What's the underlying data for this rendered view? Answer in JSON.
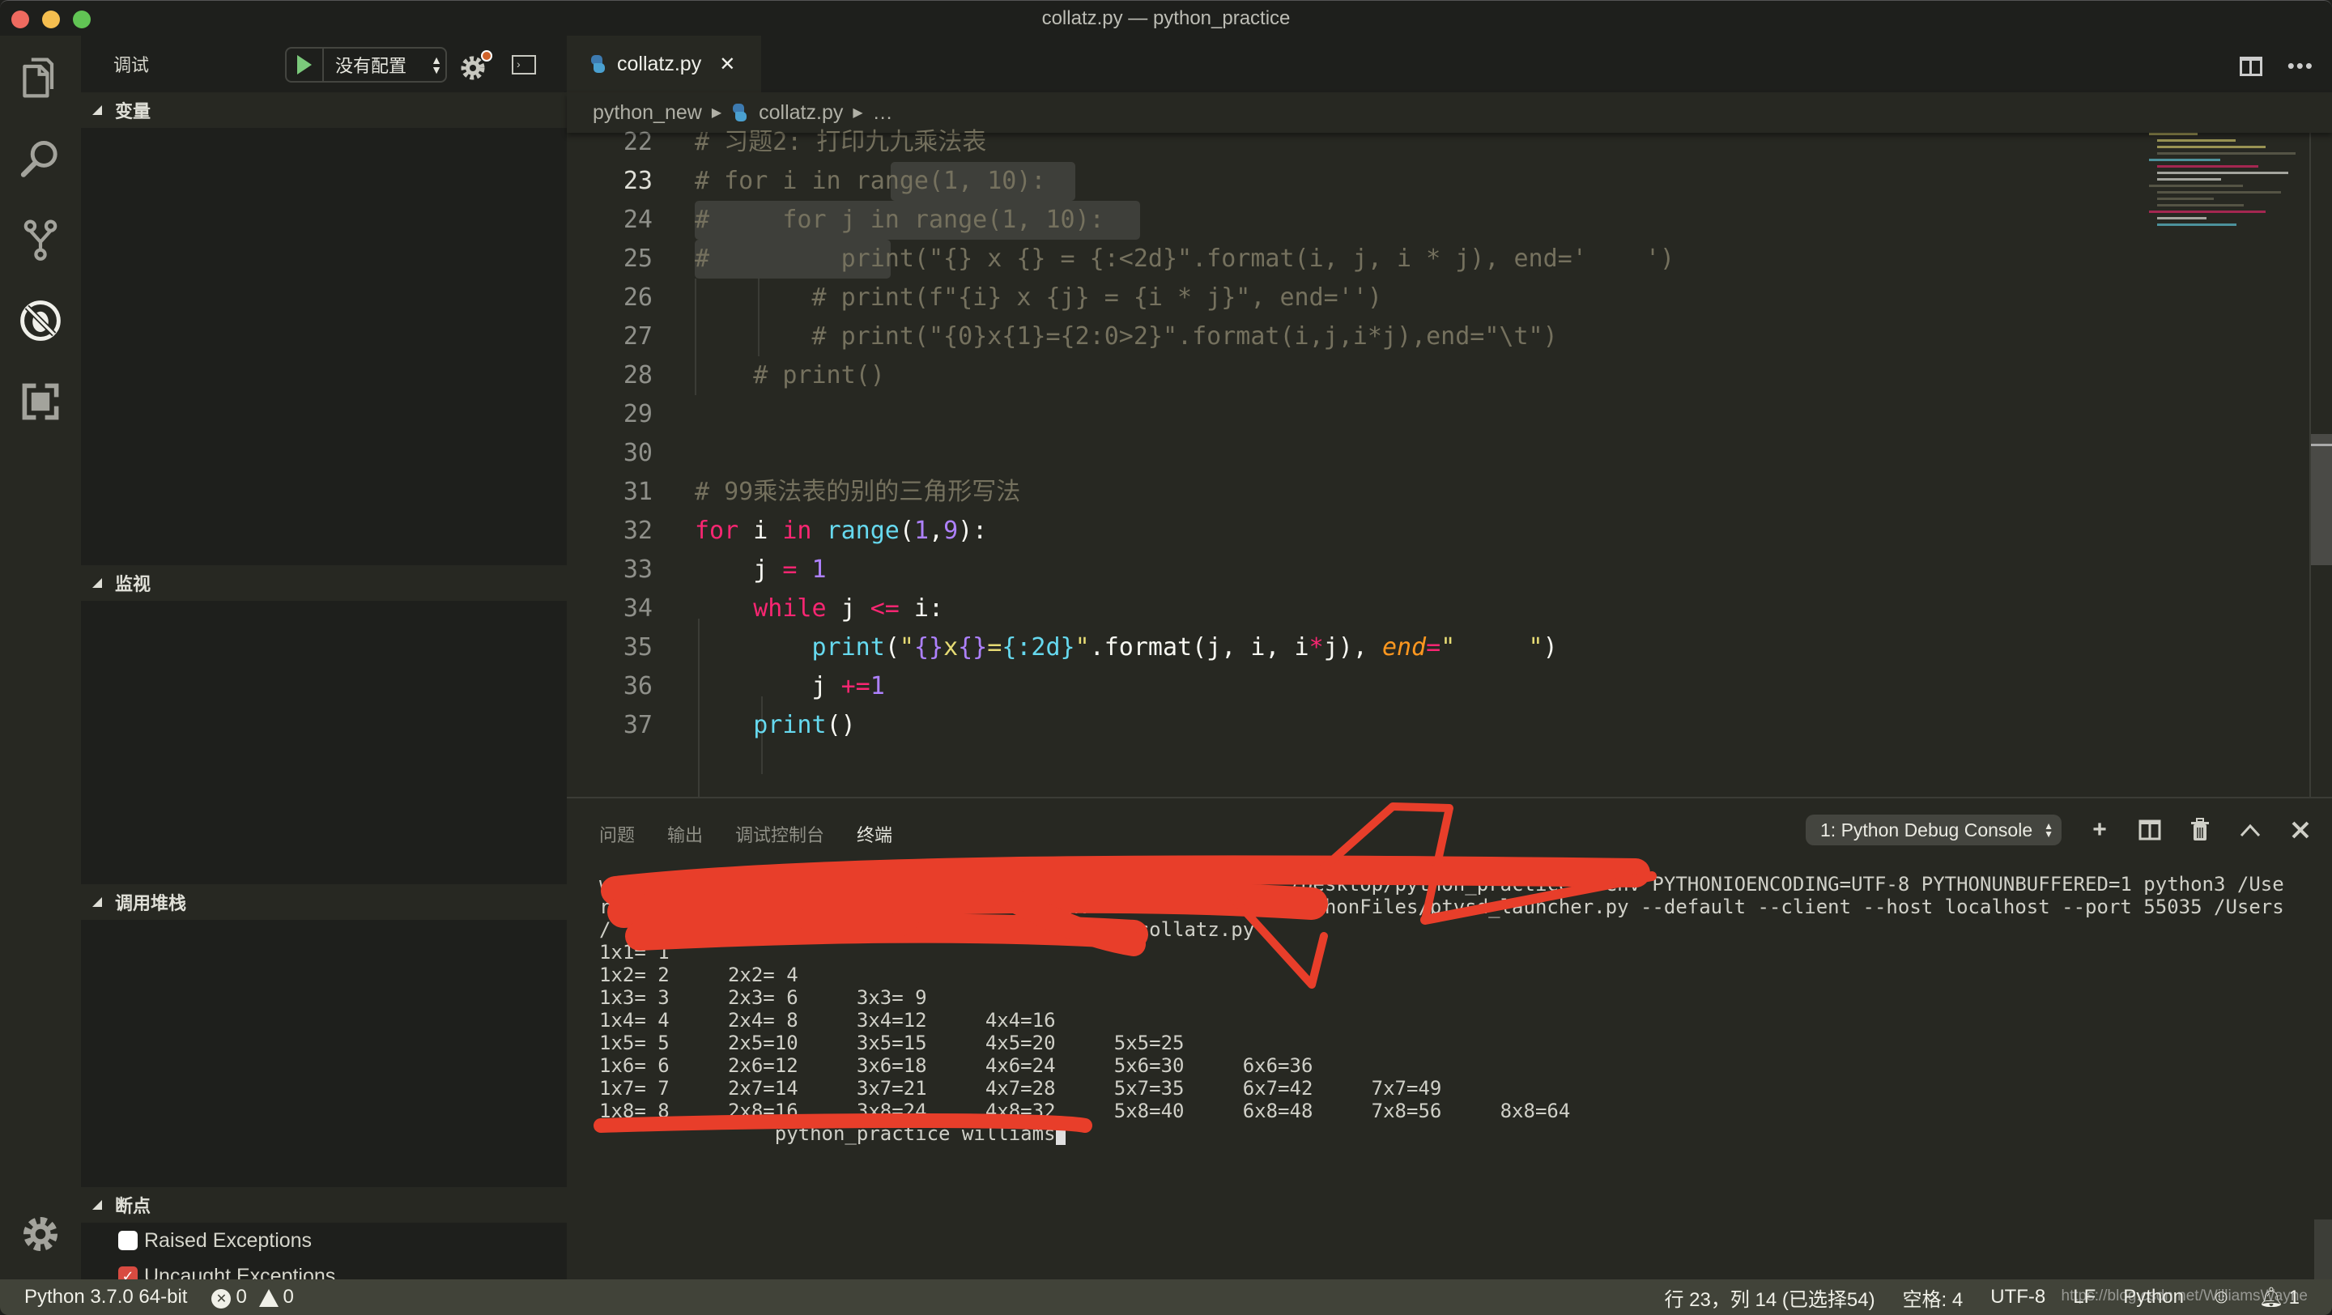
{
  "window": {
    "title": "collatz.py — python_practice"
  },
  "activity_bar": {
    "items": [
      {
        "name": "explorer",
        "icon": "files-icon"
      },
      {
        "name": "search",
        "icon": "search-icon"
      },
      {
        "name": "source-control",
        "icon": "git-branch-icon"
      },
      {
        "name": "debug",
        "icon": "debug-icon",
        "active": true
      },
      {
        "name": "extensions",
        "icon": "extensions-icon"
      }
    ],
    "settings_icon": "gear-icon"
  },
  "sidebar": {
    "title": "调试",
    "config": {
      "selected": "没有配置"
    },
    "sections": {
      "variables": "变量",
      "watch": "监视",
      "call_stack": "调用堆栈",
      "breakpoints": "断点"
    },
    "breakpoints": [
      {
        "label": "Raised Exceptions",
        "checked": false
      },
      {
        "label": "Uncaught Exceptions",
        "checked": true
      }
    ]
  },
  "editor": {
    "tab": {
      "label": "collatz.py",
      "close": "✕"
    },
    "breadcrumb": {
      "folder": "python_new",
      "file": "collatz.py",
      "more": "…"
    },
    "active_line": 23,
    "lines": [
      {
        "n": "22",
        "tokens": [
          {
            "c": "cm",
            "t": "# 习题2: 打印九九乘法表"
          }
        ]
      },
      {
        "n": "23",
        "tokens": [
          {
            "c": "cm",
            "t": "# for i in range(1, 10):"
          }
        ]
      },
      {
        "n": "24",
        "tokens": [
          {
            "c": "cm",
            "t": "#     for j in range(1, 10):"
          }
        ]
      },
      {
        "n": "25",
        "tokens": [
          {
            "c": "cm",
            "t": "#         print(\"{} x {} = {:<2d}\".format(i, j, i * j), end='    ')"
          }
        ]
      },
      {
        "n": "26",
        "tokens": [
          {
            "c": "cm",
            "t": "        # print(f\"{i} x {j} = {i * j}\", end='')"
          }
        ]
      },
      {
        "n": "27",
        "tokens": [
          {
            "c": "cm",
            "t": "        # print(\"{0}x{1}={2:0>2}\".format(i,j,i*j),end=\"\\t\")"
          }
        ]
      },
      {
        "n": "28",
        "tokens": [
          {
            "c": "cm",
            "t": "    # print()"
          }
        ]
      },
      {
        "n": "29",
        "tokens": []
      },
      {
        "n": "30",
        "tokens": []
      },
      {
        "n": "31",
        "tokens": [
          {
            "c": "cm",
            "t": "# 99乘法表的别的三角形写法"
          }
        ]
      },
      {
        "n": "32",
        "tokens": [
          {
            "c": "kw",
            "t": "for"
          },
          {
            "c": "tx",
            "t": " i "
          },
          {
            "c": "kw",
            "t": "in"
          },
          {
            "c": "tx",
            "t": " "
          },
          {
            "c": "fn",
            "t": "range"
          },
          {
            "c": "tx",
            "t": "("
          },
          {
            "c": "nm",
            "t": "1"
          },
          {
            "c": "tx",
            "t": ","
          },
          {
            "c": "nm",
            "t": "9"
          },
          {
            "c": "tx",
            "t": "):"
          }
        ]
      },
      {
        "n": "33",
        "tokens": [
          {
            "c": "tx",
            "t": "    j "
          },
          {
            "c": "kw",
            "t": "="
          },
          {
            "c": "tx",
            "t": " "
          },
          {
            "c": "nm",
            "t": "1"
          }
        ]
      },
      {
        "n": "34",
        "tokens": [
          {
            "c": "tx",
            "t": "    "
          },
          {
            "c": "kw",
            "t": "while"
          },
          {
            "c": "tx",
            "t": " j "
          },
          {
            "c": "kw",
            "t": "<="
          },
          {
            "c": "tx",
            "t": " i:"
          }
        ]
      },
      {
        "n": "35",
        "tokens": [
          {
            "c": "tx",
            "t": "        "
          },
          {
            "c": "fn",
            "t": "print"
          },
          {
            "c": "tx",
            "t": "("
          },
          {
            "c": "st",
            "t": "\""
          },
          {
            "c": "nm",
            "t": "{}"
          },
          {
            "c": "st",
            "t": "x"
          },
          {
            "c": "nm",
            "t": "{}"
          },
          {
            "c": "st",
            "t": "="
          },
          {
            "c": "fn",
            "t": "{:2d}"
          },
          {
            "c": "st",
            "t": "\""
          },
          {
            "c": "tx",
            "t": ".format(j, i, i"
          },
          {
            "c": "kw",
            "t": "*"
          },
          {
            "c": "tx",
            "t": "j), "
          },
          {
            "c": "pa",
            "t": "end"
          },
          {
            "c": "kw",
            "t": "="
          },
          {
            "c": "st",
            "t": "\"     \""
          },
          {
            "c": "tx",
            "t": ")"
          }
        ]
      },
      {
        "n": "36",
        "tokens": [
          {
            "c": "tx",
            "t": "        j "
          },
          {
            "c": "kw",
            "t": "+="
          },
          {
            "c": "nm",
            "t": "1"
          }
        ]
      },
      {
        "n": "37",
        "tokens": [
          {
            "c": "tx",
            "t": "    "
          },
          {
            "c": "fn",
            "t": "print"
          },
          {
            "c": "tx",
            "t": "()"
          }
        ]
      }
    ]
  },
  "panel": {
    "tabs": [
      {
        "label": "问题",
        "active": false
      },
      {
        "label": "输出",
        "active": false
      },
      {
        "label": "调试控制台",
        "active": false
      },
      {
        "label": "终端",
        "active": true
      }
    ],
    "terminal_select": "1: Python Debug Console",
    "actions": [
      "add-terminal-icon",
      "split-terminal-icon",
      "trash-icon",
      "maximize-panel-icon",
      "close-panel-icon"
    ],
    "terminal_lines": [
      "wangyan                                                    /Desktop/python_practice ; env PYTHONIOENCODING=UTF-8 PYTHONUNBUFFERED=1 python3 /Use",
      "rs/                                  thon.                /pythonFiles/ptvsd_launcher.py --default --client --host localhost --port 55035 /Users",
      "/        /Desktop/py                   on_new/collatz.py",
      "1x1= 1",
      "1x2= 2     2x2= 4",
      "1x3= 3     2x3= 6     3x3= 9",
      "1x4= 4     2x4= 8     3x4=12     4x4=16",
      "1x5= 5     2x5=10     3x5=15     4x5=20     5x5=25",
      "1x6= 6     2x6=12     3x6=18     4x6=24     5x6=30     6x6=36",
      "1x7= 7     2x7=14     3x7=21     4x7=28     5x7=35     6x7=42     7x7=49",
      "1x8= 8     2x8=16     3x8=24     4x8=32     5x8=40     6x8=48     7x8=56     8x8=64",
      "               python_practice williams"
    ]
  },
  "statusbar": {
    "interpreter": "Python 3.7.0 64-bit",
    "errors": "0",
    "warnings": "0",
    "cursor": "行 23，列 14 (已选择54)",
    "indent": "空格: 4",
    "encoding": "UTF-8",
    "eol": "LF",
    "language": "Python",
    "notifications": "1",
    "watermark": "https://blog.csdn.net/WilliamsWayne"
  }
}
